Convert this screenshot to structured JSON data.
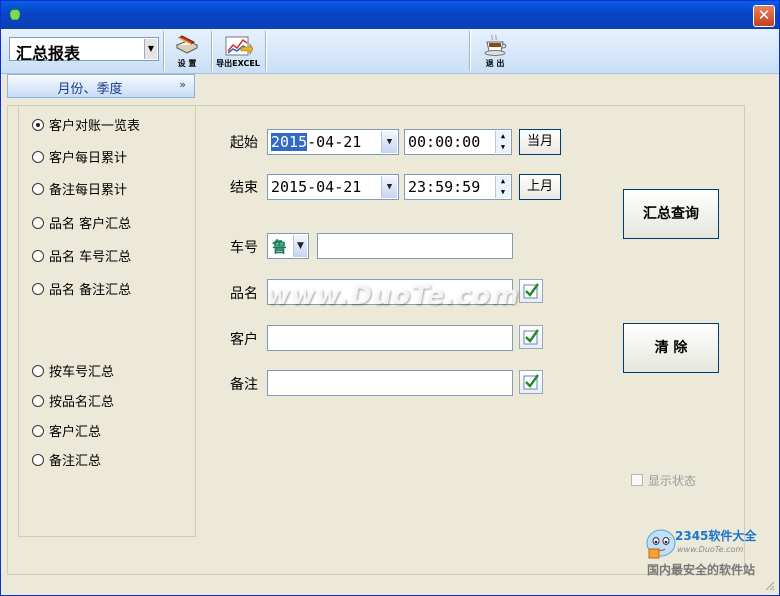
{
  "toolbar": {
    "report_select": "汇总报表",
    "settings_label": "设 置",
    "export_label": "导出EXCEL",
    "exit_label": "退 出"
  },
  "panel": {
    "title": "月份、季度"
  },
  "report_options": [
    {
      "label": "客户对账一览表",
      "selected": true
    },
    {
      "label": "客户每日累计",
      "selected": false
    },
    {
      "label": "备注每日累计",
      "selected": false
    },
    {
      "label": "品名 客户汇总",
      "selected": false
    },
    {
      "label": "品名 车号汇总",
      "selected": false
    },
    {
      "label": "品名 备注汇总",
      "selected": false
    },
    {
      "label": "按车号汇总",
      "selected": false
    },
    {
      "label": "按品名汇总",
      "selected": false
    },
    {
      "label": "客户汇总",
      "selected": false
    },
    {
      "label": "备注汇总",
      "selected": false
    }
  ],
  "form": {
    "start_label": "起始",
    "start_date_year": "2015",
    "start_date_rest": "-04-21",
    "start_time": "00:00:00",
    "this_month_button": "当月",
    "end_label": "结束",
    "end_date": "2015-04-21",
    "end_time": "23:59:59",
    "last_month_button": "上月",
    "plate_label": "车号",
    "plate_prefix": "鲁",
    "plate_value": "",
    "product_label": "品名",
    "product_value": "",
    "customer_label": "客户",
    "customer_value": "",
    "remark_label": "备注",
    "remark_value": ""
  },
  "actions": {
    "summary_query": "汇总查询",
    "clear": "清  除",
    "show_status": "显示状态",
    "show_status_checked": false
  },
  "watermarks": {
    "duote": "www.DuoTe.com",
    "brand_2345": "2345软件大全",
    "brand_url": "www.DuoTe.com",
    "brand_slogan": "国内最安全的软件站"
  }
}
